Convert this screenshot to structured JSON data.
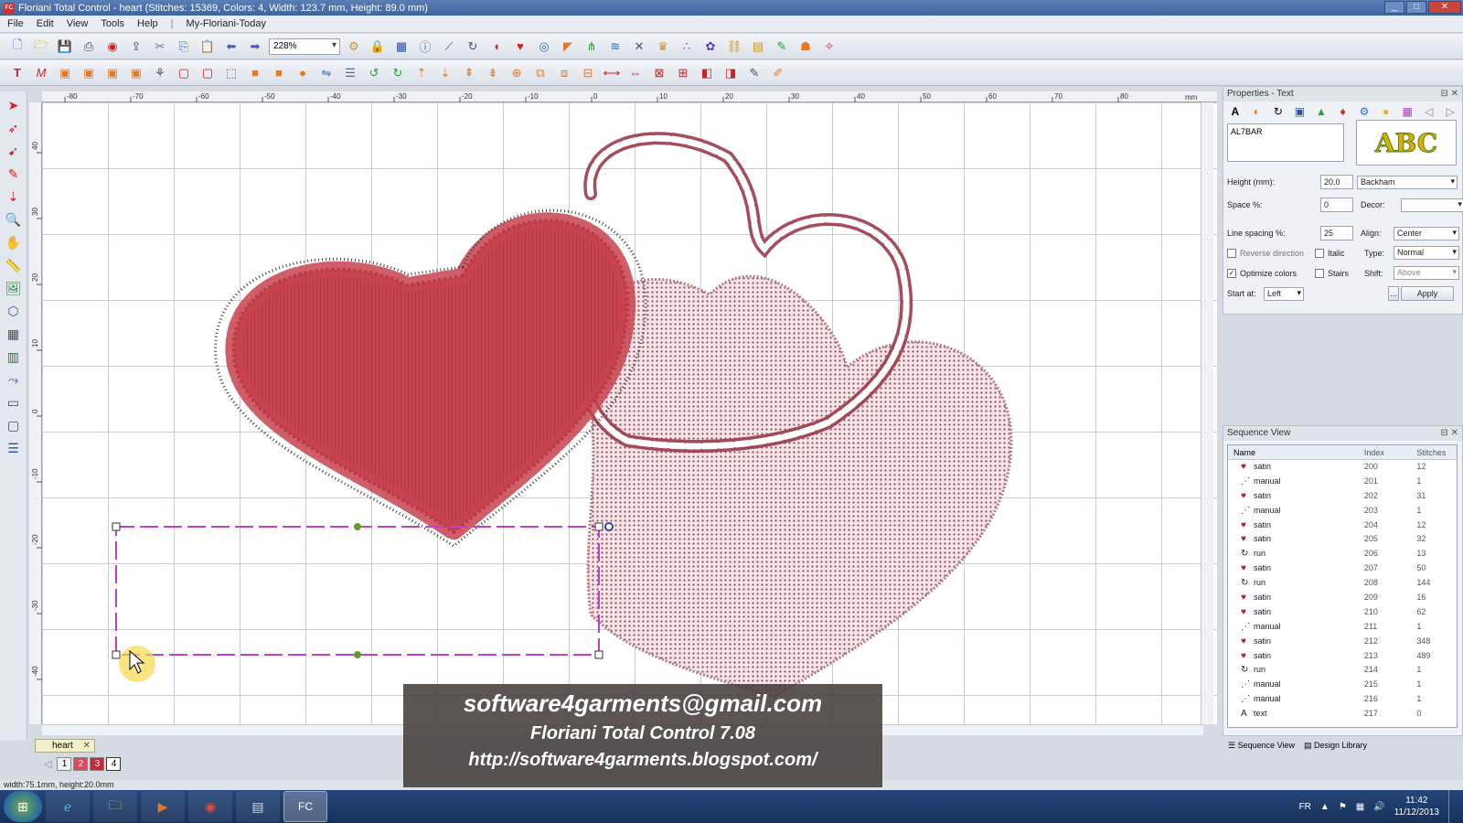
{
  "window": {
    "title": "Floriani Total Control - heart (Stitches: 15369, Colors: 4, Width: 123.7 mm, Height: 89.0 mm)",
    "app_icon": "fc-icon",
    "controls": [
      "minimize",
      "maximize",
      "close"
    ]
  },
  "menu": [
    "File",
    "Edit",
    "View",
    "Tools",
    "Help",
    "My-Floriani-Today"
  ],
  "toolbar": {
    "zoom": "228%"
  },
  "tabs": [
    {
      "label": "heart"
    }
  ],
  "color_swatches": [
    {
      "label": "1",
      "color": "#f0f0f0"
    },
    {
      "label": "2",
      "color": "#d94b5a"
    },
    {
      "label": "3",
      "color": "#c8283a"
    },
    {
      "label": "4",
      "color": "#ffffff"
    }
  ],
  "status": "width:75.1mm, height:20.0mm",
  "properties_text": {
    "title": "Properties - Text",
    "font_list_item": "AL7BAR",
    "preview": "ABC",
    "height_label": "Height (mm):",
    "height_value": "20.0",
    "font_name": "Backham",
    "space_label": "Space %:",
    "space_value": "0",
    "decor_label": "Decor:",
    "line_spacing_label": "Line spacing %:",
    "line_spacing_value": "25",
    "align_label": "Align:",
    "align_value": "Center",
    "reverse_label": "Reverse direction",
    "italic_label": "Italic",
    "type_label": "Type:",
    "type_value": "Normal",
    "optimize_label": "Optimize colors",
    "stairs_label": "Stairs",
    "shift_label": "Shift:",
    "shift_value": "Above",
    "start_label": "Start at:",
    "start_value": "Left",
    "more_label": "...",
    "apply_label": "Apply"
  },
  "sequence": {
    "title": "Sequence View",
    "columns": [
      "Name",
      "Index",
      "Stitches"
    ],
    "rows": [
      {
        "name": "satin",
        "index": "200",
        "stitches": "12"
      },
      {
        "name": "manual",
        "index": "201",
        "stitches": "1"
      },
      {
        "name": "satin",
        "index": "202",
        "stitches": "31"
      },
      {
        "name": "manual",
        "index": "203",
        "stitches": "1"
      },
      {
        "name": "satin",
        "index": "204",
        "stitches": "12"
      },
      {
        "name": "satin",
        "index": "205",
        "stitches": "32"
      },
      {
        "name": "run",
        "index": "206",
        "stitches": "13"
      },
      {
        "name": "satin",
        "index": "207",
        "stitches": "50"
      },
      {
        "name": "run",
        "index": "208",
        "stitches": "144"
      },
      {
        "name": "satin",
        "index": "209",
        "stitches": "16"
      },
      {
        "name": "satin",
        "index": "210",
        "stitches": "62"
      },
      {
        "name": "manual",
        "index": "211",
        "stitches": "1"
      },
      {
        "name": "satin",
        "index": "212",
        "stitches": "348"
      },
      {
        "name": "satin",
        "index": "213",
        "stitches": "489"
      },
      {
        "name": "run",
        "index": "214",
        "stitches": "1"
      },
      {
        "name": "manual",
        "index": "215",
        "stitches": "1"
      },
      {
        "name": "manual",
        "index": "216",
        "stitches": "1"
      },
      {
        "name": "text",
        "index": "217",
        "stitches": "0"
      }
    ],
    "bottom_tabs": [
      "Sequence View",
      "Design Library"
    ]
  },
  "watermark": {
    "line1": "software4garments@gmail.com",
    "line2": "Floriani Total Control 7.08",
    "line3": "http://software4garments.blogspot.com/"
  },
  "taskbar": {
    "lang": "FR",
    "time": "11:42",
    "date": "11/12/2013",
    "apps": [
      "windows-start-icon",
      "ie-icon",
      "explorer-icon",
      "media-player-icon",
      "chrome-icon",
      "app-icon",
      "floriani-icon"
    ]
  },
  "ruler": {
    "h_ticks": [
      "-80",
      "-70",
      "-60",
      "-50",
      "-40",
      "-30",
      "-20",
      "-10",
      "0",
      "10",
      "20",
      "30",
      "40",
      "50",
      "60",
      "70",
      "80"
    ],
    "v_ticks": [
      "40",
      "30",
      "20",
      "10",
      "0",
      "-10",
      "-20",
      "-30",
      "-40"
    ],
    "unit": "mm"
  }
}
